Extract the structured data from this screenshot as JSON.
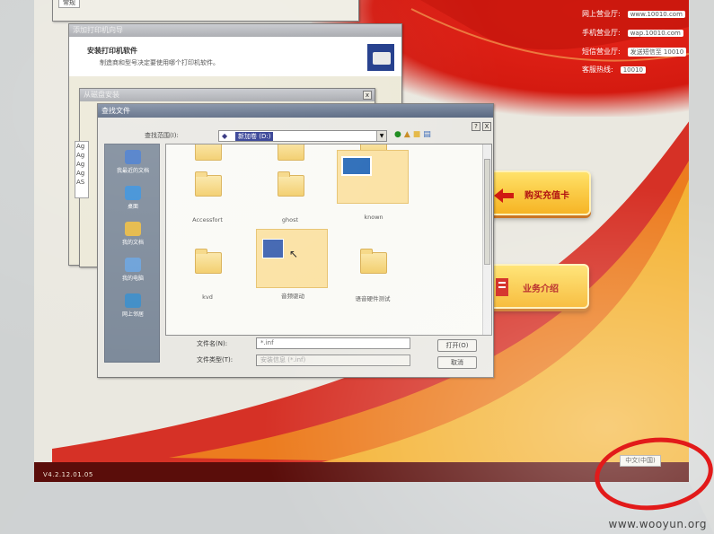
{
  "background_windows": {
    "top_tab": "常规",
    "printer_wizard_title": "添加打印机向导",
    "printer_wizard_heading": "安装打印机软件",
    "printer_wizard_desc": "制造商和型号决定要使用哪个打印机软件。",
    "printer_install_title": "从磁盘安装",
    "list_items": [
      "Ag",
      "Ag",
      "Ag",
      "Ag",
      "AS"
    ]
  },
  "find_dialog": {
    "title": "查找文件",
    "lookin_label": "查找范围(I):",
    "lookin_value": "新加卷 (D:)",
    "help_btn": "?",
    "close_btn": "X",
    "places": [
      {
        "label": "我最近的文档",
        "icon": "recent-docs-icon",
        "color": "#4a7bc8"
      },
      {
        "label": "桌面",
        "icon": "desktop-icon",
        "color": "#3d8fd6"
      },
      {
        "label": "我的文档",
        "icon": "my-documents-icon",
        "color": "#e4b846"
      },
      {
        "label": "我的电脑",
        "icon": "my-computer-icon",
        "color": "#6aa0d8"
      },
      {
        "label": "网上邻居",
        "icon": "network-places-icon",
        "color": "#3e8cc6"
      }
    ],
    "files": [
      {
        "name": "",
        "type": "folder"
      },
      {
        "name": "",
        "type": "folder"
      },
      {
        "name": "",
        "type": "folder"
      },
      {
        "name": "Accessfort",
        "type": "folder"
      },
      {
        "name": "ghost",
        "type": "folder"
      },
      {
        "name": "known",
        "type": "folder",
        "selected": true
      },
      {
        "name": "kvd",
        "type": "folder"
      },
      {
        "name": "音频驱动",
        "type": "folder",
        "selected": true
      },
      {
        "name": "语音硬件测试",
        "type": "folder"
      }
    ],
    "filename_label": "文件名(N):",
    "filename_value": "*.inf",
    "filetype_label": "文件类型(T):",
    "filetype_value": "安装信息 (*.inf)",
    "open_btn": "打开(O)",
    "cancel_btn": "取消"
  },
  "kiosk": {
    "hotline_rows": [
      {
        "label": "网上营业厅:",
        "value": "www.10010.com"
      },
      {
        "label": "手机营业厅:",
        "value": "wap.10010.com"
      },
      {
        "label": "短信营业厅:",
        "value": "发送短信至 10010"
      },
      {
        "label": "客服热线:",
        "value": "10010"
      }
    ],
    "buttons": [
      {
        "label": "购买充值卡",
        "icon": "recharge-card-icon"
      },
      {
        "label": "业务介绍",
        "icon": "service-intro-icon"
      }
    ],
    "version": "V4.2.12.01.05",
    "language_button": "中文(中国)",
    "brand_color": "#d41a10"
  },
  "watermark": "www.wooyun.org"
}
